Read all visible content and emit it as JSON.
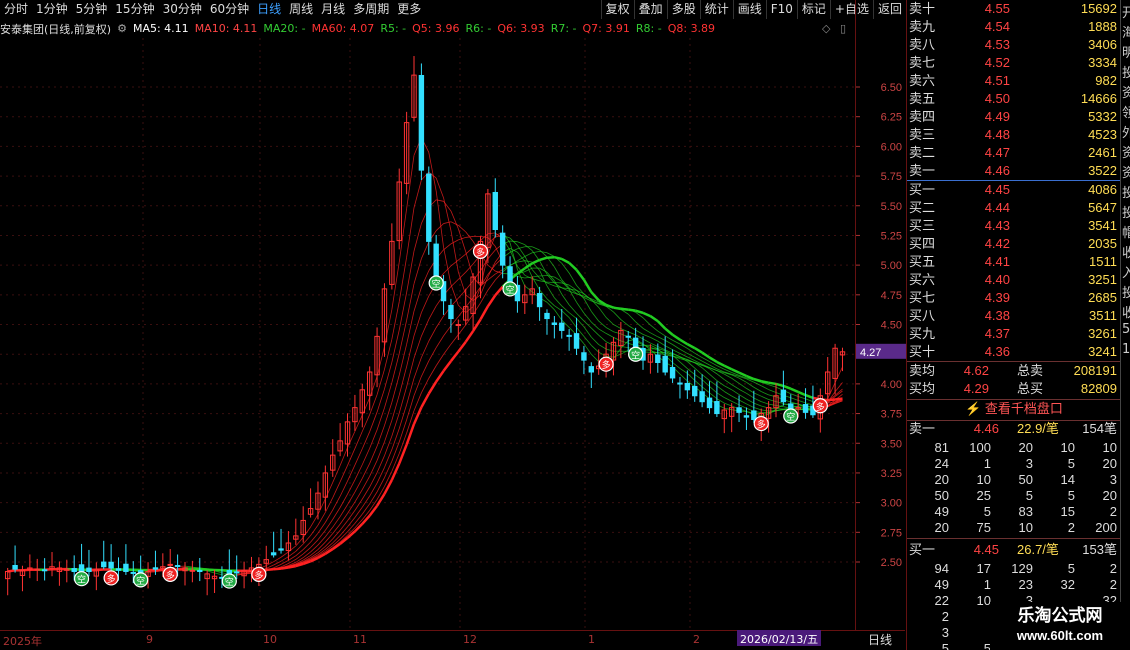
{
  "toolbar": {
    "periods": [
      "分时",
      "1分钟",
      "5分钟",
      "15分钟",
      "30分钟",
      "60分钟",
      "日线",
      "周线",
      "月线",
      "多周期",
      "更多"
    ],
    "active": "日线",
    "right_buttons": [
      "复权",
      "叠加",
      "多股",
      "统计",
      "画线",
      "F10",
      "标记",
      "+自选",
      "返回"
    ]
  },
  "info": {
    "title": "安泰集团(日线,前复权)",
    "indicators": [
      {
        "text": "MA5: 4.11",
        "color": "#ffffff"
      },
      {
        "text": "MA10: 4.11",
        "color": "#ff4444"
      },
      {
        "text": "MA20: -",
        "color": "#33cc33"
      },
      {
        "text": "MA60: 4.07",
        "color": "#ff3333"
      },
      {
        "text": "R5: -",
        "color": "#33cc33"
      },
      {
        "text": "Q5: 3.96",
        "color": "#ff3333"
      },
      {
        "text": "R6: -",
        "color": "#33cc33"
      },
      {
        "text": "Q6: 3.93",
        "color": "#ff3333"
      },
      {
        "text": "R7: -",
        "color": "#33cc33"
      },
      {
        "text": "Q7: 3.91",
        "color": "#ff3333"
      },
      {
        "text": "R8: -",
        "color": "#33cc33"
      },
      {
        "text": "Q8: 3.89",
        "color": "#ff3333"
      }
    ]
  },
  "yaxis": {
    "ticks": [
      "6.50",
      "6.25",
      "6.00",
      "5.75",
      "5.50",
      "5.25",
      "5.00",
      "4.75",
      "4.50",
      "4.25",
      "4.00",
      "3.75",
      "3.50",
      "3.25",
      "3.00",
      "2.75",
      "2.50"
    ],
    "current": "4.27"
  },
  "xaxis": {
    "labels": [
      "2025年",
      "9",
      "10",
      "11",
      "12",
      "1",
      "2"
    ],
    "cursor_date": "2026/02/13/五",
    "period_label": "日线"
  },
  "chart_data": {
    "type": "candlestick",
    "ylim": [
      2.2,
      7.0
    ],
    "closes": [
      2.42,
      2.44,
      2.43,
      2.45,
      2.44,
      2.43,
      2.46,
      2.45,
      2.44,
      2.42,
      2.41,
      2.42,
      2.44,
      2.46,
      2.45,
      2.43,
      2.42,
      2.41,
      2.4,
      2.42,
      2.44,
      2.46,
      2.48,
      2.47,
      2.45,
      2.43,
      2.42,
      2.4,
      2.38,
      2.37,
      2.39,
      2.41,
      2.43,
      2.45,
      2.48,
      2.52,
      2.56,
      2.6,
      2.66,
      2.72,
      2.85,
      2.95,
      3.08,
      3.25,
      3.4,
      3.52,
      3.68,
      3.8,
      3.95,
      4.1,
      4.4,
      4.8,
      5.2,
      5.7,
      6.2,
      6.6,
      5.8,
      5.2,
      4.9,
      4.7,
      4.55,
      4.5,
      4.65,
      4.9,
      5.2,
      5.6,
      5.3,
      5.0,
      4.85,
      4.7,
      4.75,
      4.8,
      4.65,
      4.55,
      4.5,
      4.45,
      4.4,
      4.3,
      4.2,
      4.1,
      4.15,
      4.25,
      4.35,
      4.45,
      4.4,
      4.3,
      4.2,
      4.25,
      4.18,
      4.1,
      4.05,
      4.0,
      3.95,
      3.9,
      3.85,
      3.8,
      3.75,
      3.78,
      3.8,
      3.76,
      3.72,
      3.7,
      3.75,
      3.8,
      3.9,
      3.85,
      3.78,
      3.8,
      3.76,
      3.74,
      3.9,
      4.1,
      4.3,
      4.27
    ],
    "signals": [
      {
        "i": 10,
        "t": "空"
      },
      {
        "i": 14,
        "t": "多"
      },
      {
        "i": 18,
        "t": "空"
      },
      {
        "i": 22,
        "t": "多"
      },
      {
        "i": 30,
        "t": "空"
      },
      {
        "i": 34,
        "t": "多"
      },
      {
        "i": 58,
        "t": "空"
      },
      {
        "i": 64,
        "t": "多"
      },
      {
        "i": 68,
        "t": "空"
      },
      {
        "i": 81,
        "t": "多"
      },
      {
        "i": 85,
        "t": "空"
      },
      {
        "i": 102,
        "t": "多"
      },
      {
        "i": 106,
        "t": "空"
      },
      {
        "i": 110,
        "t": "多"
      }
    ]
  },
  "orderbook": {
    "sells": [
      {
        "label": "卖十",
        "price": "4.55",
        "vol": "15692"
      },
      {
        "label": "卖九",
        "price": "4.54",
        "vol": "1888"
      },
      {
        "label": "卖八",
        "price": "4.53",
        "vol": "3406"
      },
      {
        "label": "卖七",
        "price": "4.52",
        "vol": "3334"
      },
      {
        "label": "卖六",
        "price": "4.51",
        "vol": "982"
      },
      {
        "label": "卖五",
        "price": "4.50",
        "vol": "14666"
      },
      {
        "label": "卖四",
        "price": "4.49",
        "vol": "5332"
      },
      {
        "label": "卖三",
        "price": "4.48",
        "vol": "4523"
      },
      {
        "label": "卖二",
        "price": "4.47",
        "vol": "2461"
      },
      {
        "label": "卖一",
        "price": "4.46",
        "vol": "3522"
      }
    ],
    "buys": [
      {
        "label": "买一",
        "price": "4.45",
        "vol": "4086"
      },
      {
        "label": "买二",
        "price": "4.44",
        "vol": "5647"
      },
      {
        "label": "买三",
        "price": "4.43",
        "vol": "3541"
      },
      {
        "label": "买四",
        "price": "4.42",
        "vol": "2035"
      },
      {
        "label": "买五",
        "price": "4.41",
        "vol": "1511"
      },
      {
        "label": "买六",
        "price": "4.40",
        "vol": "3251"
      },
      {
        "label": "买七",
        "price": "4.39",
        "vol": "2685"
      },
      {
        "label": "买八",
        "price": "4.38",
        "vol": "3511"
      },
      {
        "label": "买九",
        "price": "4.37",
        "vol": "3261"
      },
      {
        "label": "买十",
        "price": "4.36",
        "vol": "3241"
      }
    ],
    "avg_sell_label": "卖均",
    "avg_sell": "4.62",
    "total_sell_label": "总卖",
    "total_sell": "208191",
    "avg_buy_label": "买均",
    "avg_buy": "4.29",
    "total_buy_label": "总买",
    "total_buy": "82809",
    "qt_button": "查看千档盘口",
    "sell1": {
      "label": "卖一",
      "price": "4.46",
      "avg": "22.9/笔",
      "count": "154笔"
    },
    "sell1_grid": [
      [
        "81",
        "100",
        "20",
        "10",
        "10"
      ],
      [
        "24",
        "1",
        "3",
        "5",
        "20"
      ],
      [
        "20",
        "10",
        "50",
        "14",
        "3"
      ],
      [
        "50",
        "25",
        "5",
        "5",
        "20"
      ],
      [
        "49",
        "5",
        "83",
        "15",
        "2"
      ],
      [
        "20",
        "75",
        "10",
        "2",
        "200"
      ]
    ],
    "buy1": {
      "label": "买一",
      "price": "4.45",
      "avg": "26.7/笔",
      "count": "153笔"
    },
    "buy1_grid": [
      [
        "94",
        "17",
        "129",
        "5",
        "2"
      ],
      [
        "49",
        "1",
        "23",
        "32",
        "2"
      ],
      [
        "22",
        "10",
        "3",
        "",
        "32"
      ],
      [
        "2",
        "",
        "",
        "",
        ""
      ],
      [
        "3",
        "",
        "",
        "",
        ""
      ],
      [
        "5",
        "5",
        "",
        "",
        ""
      ]
    ]
  },
  "right_edge": [
    "开",
    "海",
    "明",
    "投",
    "资",
    "领",
    "外",
    "资",
    "资",
    "投",
    "投",
    "帽",
    "收",
    "入",
    "投",
    "收",
    "5",
    "1"
  ],
  "watermark": {
    "line1": "乐淘公式网",
    "line2": "www.60lt.com"
  }
}
